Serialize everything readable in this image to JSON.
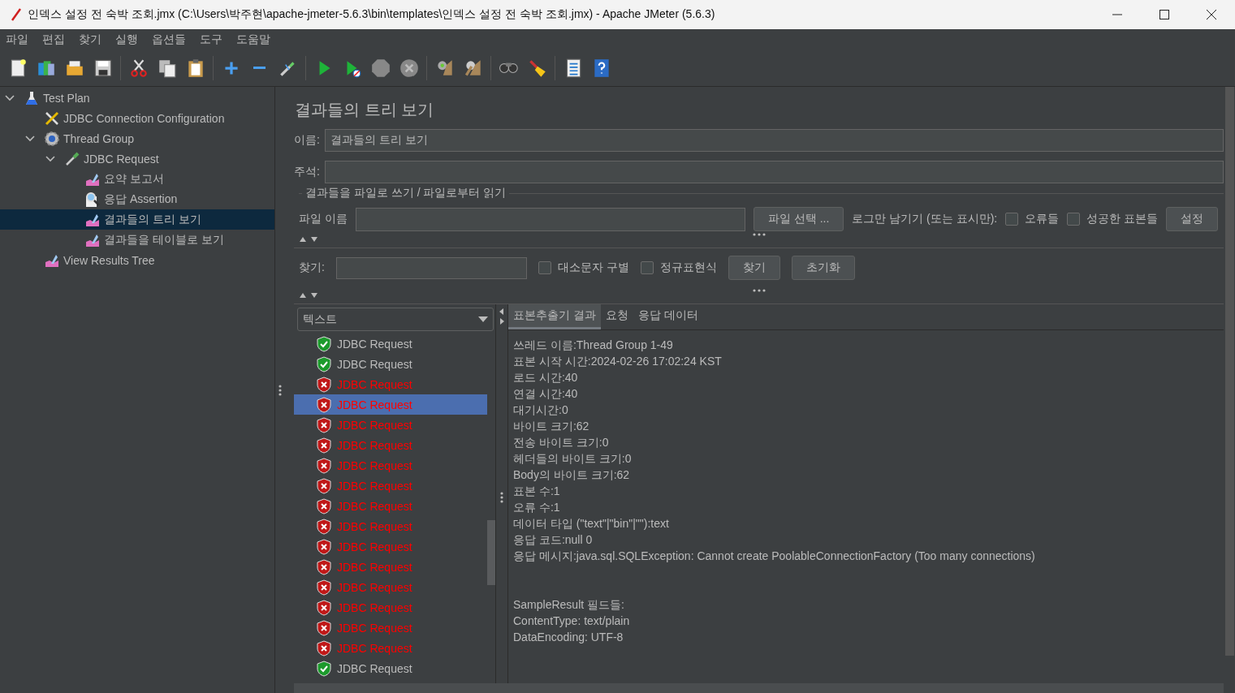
{
  "window": {
    "title": "인덱스 설정 전 숙박 조회.jmx (C:\\Users\\박주현\\apache-jmeter-5.6.3\\bin\\templates\\인덱스 설정 전 숙박 조회.jmx) - Apache JMeter (5.6.3)"
  },
  "menu": [
    "파일",
    "편집",
    "찾기",
    "실행",
    "옵션들",
    "도구",
    "도움말"
  ],
  "tree": [
    {
      "label": "Test Plan",
      "kind": "plan",
      "expanded": true,
      "selected": false,
      "children": [
        {
          "label": "JDBC Connection Configuration",
          "kind": "config",
          "selected": false
        },
        {
          "label": "Thread Group",
          "kind": "thread",
          "expanded": true,
          "selected": false,
          "children": [
            {
              "label": "JDBC Request",
              "kind": "sampler",
              "expanded": true,
              "selected": false,
              "children": [
                {
                  "label": "요약 보고서",
                  "kind": "listener",
                  "selected": false
                },
                {
                  "label": "응답 Assertion",
                  "kind": "assertion",
                  "selected": false
                },
                {
                  "label": "결과들의 트리 보기",
                  "kind": "listener",
                  "selected": true
                },
                {
                  "label": "결과들을 테이블로 보기",
                  "kind": "listener",
                  "selected": false
                }
              ]
            }
          ]
        },
        {
          "label": "View Results Tree",
          "kind": "listener",
          "selected": false
        }
      ]
    }
  ],
  "panel": {
    "title": "결과들의 트리 보기",
    "name_label": "이름:",
    "name_value": "결과들의 트리 보기",
    "comment_label": "주석:",
    "file_group": {
      "title": "결과들을 파일로 쓰기 / 파일로부터 읽기",
      "file_label": "파일 이름",
      "browse_button": "파일 선택 ...",
      "log_label": "로그만 남기기 (또는 표시만):",
      "errors": {
        "label": "오류들",
        "checked": false
      },
      "successes": {
        "label": "성공한 표본들",
        "checked": false
      },
      "configure_button": "설정"
    }
  },
  "search": {
    "label": "찾기:",
    "case_sensitive": {
      "label": "대소문자 구별",
      "checked": false
    },
    "regex": {
      "label": "정규표현식",
      "checked": false
    },
    "find_button": "찾기",
    "reset_button": "초기화"
  },
  "results": {
    "renderer": "텍스트",
    "samples": [
      {
        "label": "JDBC Request",
        "failed": false,
        "selected": false
      },
      {
        "label": "JDBC Request",
        "failed": false,
        "selected": false
      },
      {
        "label": "JDBC Request",
        "failed": true,
        "selected": false
      },
      {
        "label": "JDBC Request",
        "failed": true,
        "selected": true
      },
      {
        "label": "JDBC Request",
        "failed": true,
        "selected": false
      },
      {
        "label": "JDBC Request",
        "failed": true,
        "selected": false
      },
      {
        "label": "JDBC Request",
        "failed": true,
        "selected": false
      },
      {
        "label": "JDBC Request",
        "failed": true,
        "selected": false
      },
      {
        "label": "JDBC Request",
        "failed": true,
        "selected": false
      },
      {
        "label": "JDBC Request",
        "failed": true,
        "selected": false
      },
      {
        "label": "JDBC Request",
        "failed": true,
        "selected": false
      },
      {
        "label": "JDBC Request",
        "failed": true,
        "selected": false
      },
      {
        "label": "JDBC Request",
        "failed": true,
        "selected": false
      },
      {
        "label": "JDBC Request",
        "failed": true,
        "selected": false
      },
      {
        "label": "JDBC Request",
        "failed": true,
        "selected": false
      },
      {
        "label": "JDBC Request",
        "failed": true,
        "selected": false
      },
      {
        "label": "JDBC Request",
        "failed": false,
        "selected": false
      }
    ]
  },
  "detail": {
    "tabs": [
      {
        "label": "표본추출기 결과",
        "selected": true
      },
      {
        "label": "요청",
        "selected": false
      },
      {
        "label": "응답 데이터",
        "selected": false
      }
    ],
    "lines": [
      "쓰레드 이름:Thread Group 1-49",
      "표본 시작 시간:2024-02-26 17:02:24 KST",
      "로드 시간:40",
      "연결 시간:40",
      "대기시간:0",
      "바이트 크기:62",
      "전송 바이트 크기:0",
      "헤더들의 바이트 크기:0",
      "Body의 바이트 크기:62",
      "표본 수:1",
      "오류 수:1",
      "데이터 타입 (\"text\"|\"bin\"|\"\"):text",
      "응답 코드:null 0",
      "응답 메시지:java.sql.SQLException: Cannot create PoolableConnectionFactory (Too many connections)"
    ],
    "field_lines": [
      "SampleResult 필드들:",
      "ContentType: text/plain",
      "DataEncoding: UTF-8"
    ]
  }
}
